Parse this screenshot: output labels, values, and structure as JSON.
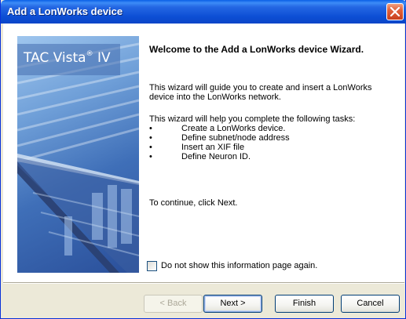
{
  "window": {
    "title": "Add a LonWorks device"
  },
  "side_panel": {
    "brand": "TAC Vista",
    "brand_mark": "®",
    "brand_suffix": " IV"
  },
  "main": {
    "heading": "Welcome to the Add a LonWorks device Wizard.",
    "intro_line1": "This wizard will guide you to create and insert a LonWorks",
    "intro_line2": "device into the LonWorks network.",
    "tasks_intro": "This wizard will help you complete the following tasks:",
    "tasks": [
      {
        "bullet": "•",
        "text": "Create a LonWorks device."
      },
      {
        "bullet": "•",
        "text": "Define subnet/node address"
      },
      {
        "bullet": "•",
        "text": "Insert an XIF file"
      },
      {
        "bullet": "•",
        "text": "Define Neuron ID."
      }
    ],
    "continue_text": "To continue, click Next."
  },
  "checkbox": {
    "label": "Do not show this information page again.",
    "checked": false
  },
  "buttons": {
    "back": "< Back",
    "next": "Next >",
    "finish": "Finish",
    "cancel": "Cancel"
  }
}
